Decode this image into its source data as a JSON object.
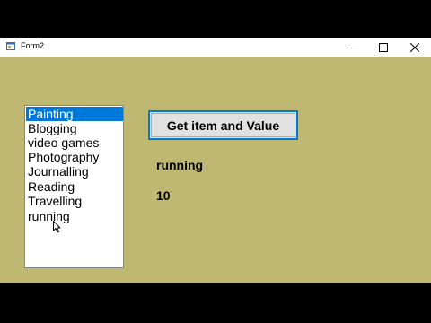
{
  "window": {
    "title": "Form2",
    "icon": "form-app-icon",
    "controls": [
      "minimize-icon",
      "maximize-icon",
      "close-icon"
    ]
  },
  "listbox": {
    "items": [
      "Painting",
      "Blogging",
      "video games",
      "Photography",
      "Journalling",
      "Reading",
      "Travelling",
      "running"
    ],
    "selected_index": 0
  },
  "button": {
    "label": "Get item and Value"
  },
  "labels": {
    "item": "running",
    "value": "10"
  },
  "colors": {
    "form_background": "#bfb873",
    "selection": "#0078d7",
    "button_face": "#e1e1e1",
    "button_focus_border": "#0078d7"
  }
}
